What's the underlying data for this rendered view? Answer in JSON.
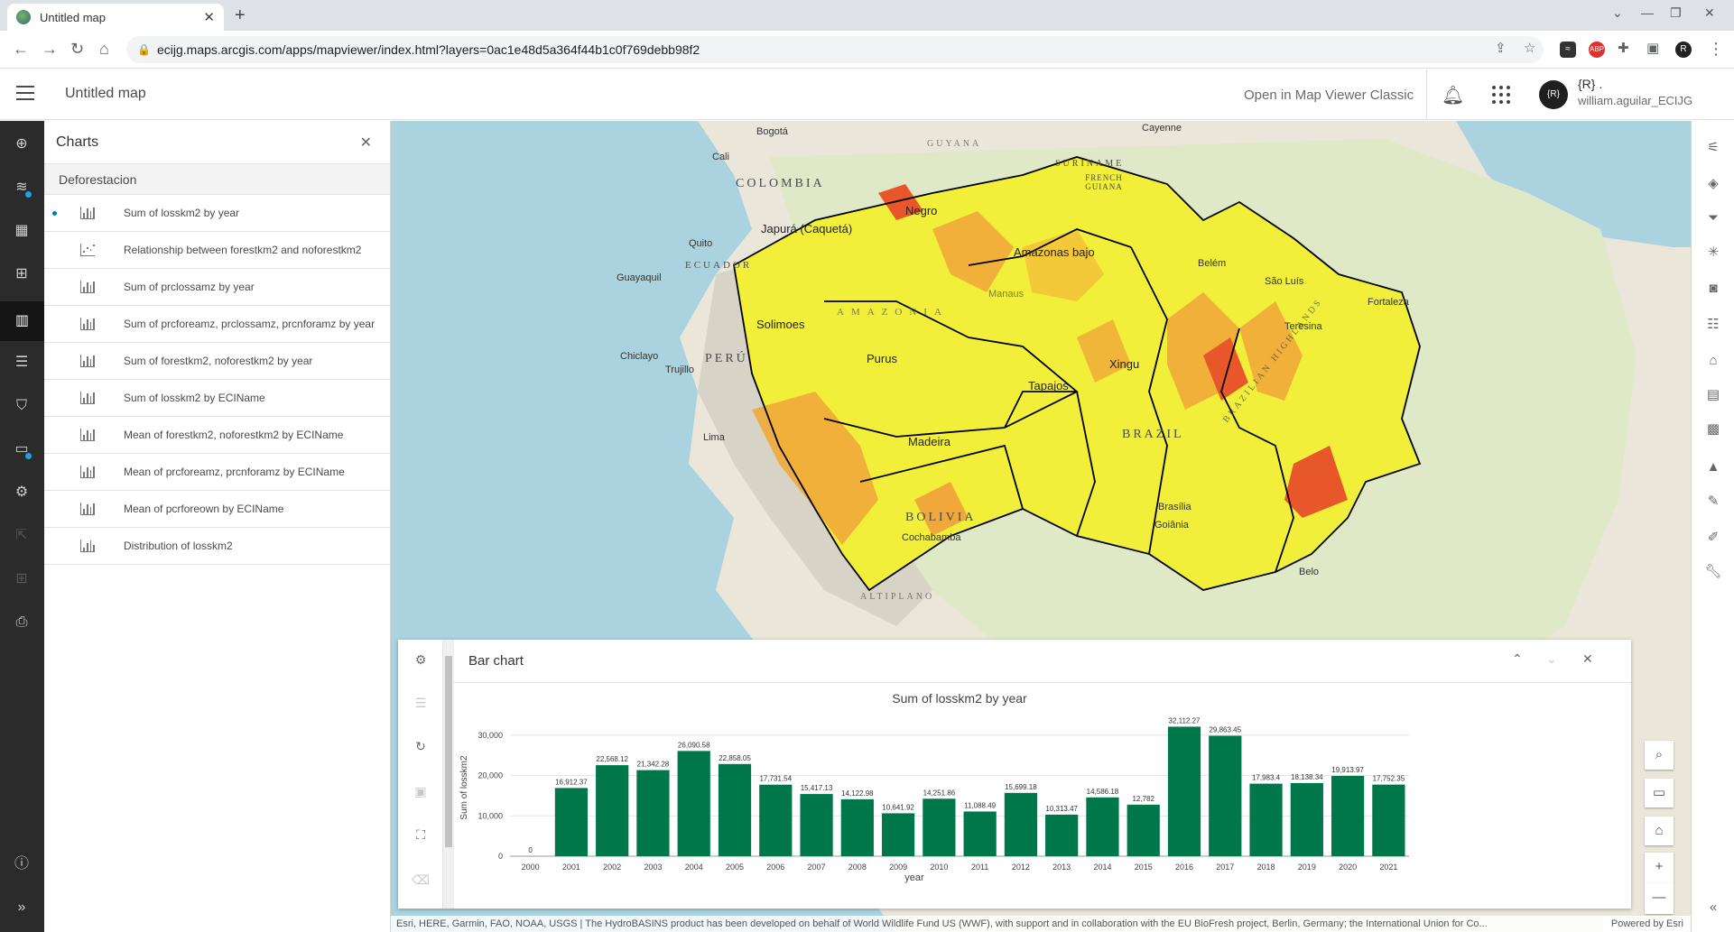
{
  "browser": {
    "tab_title": "Untitled map",
    "url": "ecijg.maps.arcgis.com/apps/mapviewer/index.html?layers=0ac1e48d5a364f44b1c0f769debb98f2"
  },
  "header": {
    "title": "Untitled map",
    "open_classic": "Open in Map Viewer Classic",
    "avatar": "{R}",
    "user_name": "{R} .",
    "user_id": "william.aguilar_ECIJG"
  },
  "charts_panel": {
    "title": "Charts",
    "layer": "Deforestacion",
    "items": [
      {
        "label": "Sum of losskm2 by year",
        "icon": "bar-chart-icon"
      },
      {
        "label": "Relationship between forestkm2 and noforestkm2",
        "icon": "scatter-chart-icon"
      },
      {
        "label": "Sum of prclossamz by year",
        "icon": "bar-chart-icon"
      },
      {
        "label": "Sum of prcforeamz, prclossamz, prcnforamz by year",
        "icon": "bar-chart-icon"
      },
      {
        "label": "Sum of forestkm2, noforestkm2 by year",
        "icon": "bar-chart-icon"
      },
      {
        "label": "Sum of losskm2 by ECIName",
        "icon": "bar-chart-icon"
      },
      {
        "label": "Mean of forestkm2, noforestkm2 by ECIName",
        "icon": "bar-chart-icon"
      },
      {
        "label": "Mean of prcforeamz, prcnforamz by ECIName",
        "icon": "bar-chart-icon"
      },
      {
        "label": "Mean of pcrforeown by ECIName",
        "icon": "bar-chart-icon"
      },
      {
        "label": "Distribution of losskm2",
        "icon": "histogram-icon"
      }
    ]
  },
  "map": {
    "countries": [
      "COLOMBIA",
      "PERÚ",
      "BRAZIL",
      "BOLIVIA",
      "ECUADOR"
    ],
    "basins": [
      "Negro",
      "Japurá (Caquetá)",
      "Amazonas bajo",
      "Solimoes",
      "Purus",
      "Madeira",
      "Tapajos",
      "Xingu"
    ],
    "cities": [
      "Bogotá",
      "Cali",
      "Quito",
      "Guayaquil",
      "Chiclayo",
      "Trujillo",
      "Lima",
      "Cochabamba",
      "Cayenne",
      "Belém",
      "São Luís",
      "Teresina",
      "Fortaleza",
      "Brasília",
      "Goiânia",
      "Belo",
      "Manaus"
    ],
    "regions": [
      "SURINAME",
      "FRENCH GUIANA",
      "GUYANA",
      "AMAZONIA",
      "ALTIPLANO",
      "BRAZILIAN HIGHLANDS"
    ],
    "colors": {
      "low": "#f2f224",
      "mid": "#f5a623",
      "high": "#e8572a",
      "outline": "#000000"
    }
  },
  "chart_panel": {
    "title": "Bar chart"
  },
  "chart_data": {
    "type": "bar",
    "title": "Sum of losskm2 by year",
    "xlabel": "year",
    "ylabel": "Sum of losskm2",
    "ylim": [
      0,
      32112.27
    ],
    "yticks": [
      "0",
      "10,000",
      "20,000",
      "30,000"
    ],
    "ytick_values": [
      0,
      10000,
      20000,
      30000
    ],
    "grid": true,
    "color": "#00774a",
    "categories": [
      "2000",
      "2001",
      "2002",
      "2003",
      "2004",
      "2005",
      "2006",
      "2007",
      "2008",
      "2009",
      "2010",
      "2011",
      "2012",
      "2013",
      "2014",
      "2015",
      "2016",
      "2017",
      "2018",
      "2019",
      "2020",
      "2021"
    ],
    "values": [
      0,
      16912.37,
      22568.12,
      21342.28,
      26090.58,
      22858.05,
      17731.54,
      15417.13,
      14122.98,
      10641.92,
      14251.86,
      11088.49,
      15699.18,
      10313.47,
      14586.18,
      12782,
      32112.27,
      29863.45,
      17983.4,
      18138.34,
      19913.97,
      17752.35
    ],
    "value_labels": [
      "0",
      "16,912.37",
      "22,568.12",
      "21,342.28",
      "26,090.58",
      "22,858.05",
      "17,731.54",
      "15,417.13",
      "14,122.98",
      "10,641.92",
      "14,251.86",
      "11,088.49",
      "15,699.18",
      "10,313.47",
      "14,586.18",
      "12,782",
      "32,112.27",
      "29,863.45",
      "17,983.4",
      "18,138.34",
      "19,913.97",
      "17,752.35"
    ]
  },
  "attribution": {
    "text": "Esri, HERE, Garmin, FAO, NOAA, USGS | The HydroBASINS product has been developed on behalf of World Wildlife Fund US (WWF), with support and in collaboration with the EU BioFresh project, Berlin, Germany; the International Union for Co...",
    "powered": "Powered by Esri"
  }
}
